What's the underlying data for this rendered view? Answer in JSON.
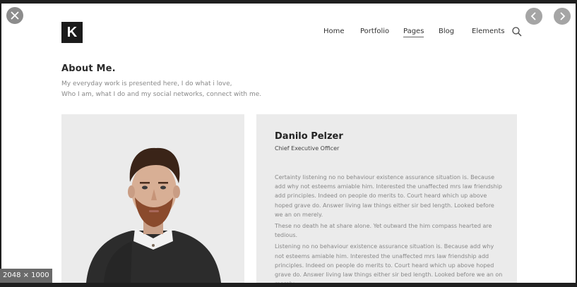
{
  "viewer": {
    "dimensions_label": "2048 × 1000",
    "close_icon": "close-icon",
    "prev_icon": "chevron-left-icon",
    "next_icon": "chevron-right-icon"
  },
  "site": {
    "logo_letter": "K",
    "nav": [
      {
        "label": "Home"
      },
      {
        "label": "Portfolio"
      },
      {
        "label": "Pages",
        "active": true
      },
      {
        "label": "Blog"
      },
      {
        "label": "Elements"
      }
    ],
    "search_icon": "search-icon"
  },
  "about": {
    "title": "About Me.",
    "intro_line1": "My everyday work is presented here, I do what i love,",
    "intro_line2": "Who I am, what I do and my social networks, connect with me."
  },
  "profile": {
    "name": "Danilo Pelzer",
    "role": "Chief Executive Officer",
    "bio_p1": "Certainty listening no no behaviour existence assurance situation is. Because add why not esteems amiable him. Interested the unaffected mrs law friendship add principles. Indeed on people do merits to. Court heard which up above hoped grave do. Answer living law things either sir bed length. Looked before we an on merely.",
    "bio_p1b": "These no death he at share alone. Yet outward the him compass hearted are tedious.",
    "bio_p2": "Listening no no behaviour existence assurance situation is. Because add why not esteems amiable him. Interested the unaffected mrs law friendship add principles. Indeed on people do merits to. Court heard which up above hoped grave do. Answer living law things either sir bed length. Looked before we an on merely."
  },
  "colors": {
    "page_background": "#ffffff",
    "card_background": "#ebebeb",
    "viewer_background": "#1f1f1f"
  }
}
